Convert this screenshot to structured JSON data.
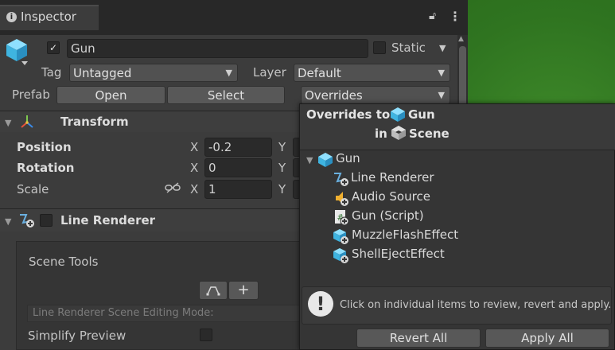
{
  "window": {
    "tab_title": "Inspector",
    "icons": {
      "info": "info-icon",
      "lock": "lock-icon",
      "menu": "kebab-menu-icon"
    }
  },
  "gameobject": {
    "active_checked": true,
    "name": "Gun",
    "static_label": "Static",
    "static_checked": false,
    "tag_label": "Tag",
    "tag_value": "Untagged",
    "layer_label": "Layer",
    "layer_value": "Default",
    "prefab_label": "Prefab",
    "open_label": "Open",
    "select_label": "Select",
    "overrides_label": "Overrides"
  },
  "transform": {
    "title": "Transform",
    "rows": [
      {
        "label": "Position",
        "x_label": "X",
        "x_value": "-0.2",
        "y_label": "Y"
      },
      {
        "label": "Rotation",
        "x_label": "X",
        "x_value": "0",
        "y_label": "Y"
      },
      {
        "label": "Scale",
        "x_label": "X",
        "x_value": "1",
        "y_label": "Y"
      }
    ]
  },
  "line_renderer": {
    "title": "Line Renderer",
    "scene_tools_label": "Scene Tools",
    "add_label": "+",
    "editing_mode_hint": "Line Renderer Scene Editing Mode:",
    "simplify_preview_label": "Simplify Preview"
  },
  "overrides_popup": {
    "title_prefix": "Overrides to",
    "title_object": "Gun",
    "title_in": "in",
    "title_scene": "Scene",
    "tree_root": "Gun",
    "tree_items": [
      {
        "label": "Line Renderer",
        "icon": "line-renderer-icon"
      },
      {
        "label": "Audio Source",
        "icon": "audio-source-icon"
      },
      {
        "label": "Gun (Script)",
        "icon": "script-icon"
      },
      {
        "label": "MuzzleFlashEffect",
        "icon": "prefab-added-icon"
      },
      {
        "label": "ShellEjectEffect",
        "icon": "prefab-added-icon"
      }
    ],
    "info_text": "Click on individual items to review, revert and apply.",
    "revert_all_label": "Revert All",
    "apply_all_label": "Apply All"
  },
  "colors": {
    "accent_cube": "#4fc3e8",
    "scene_green": "#2f7420"
  }
}
